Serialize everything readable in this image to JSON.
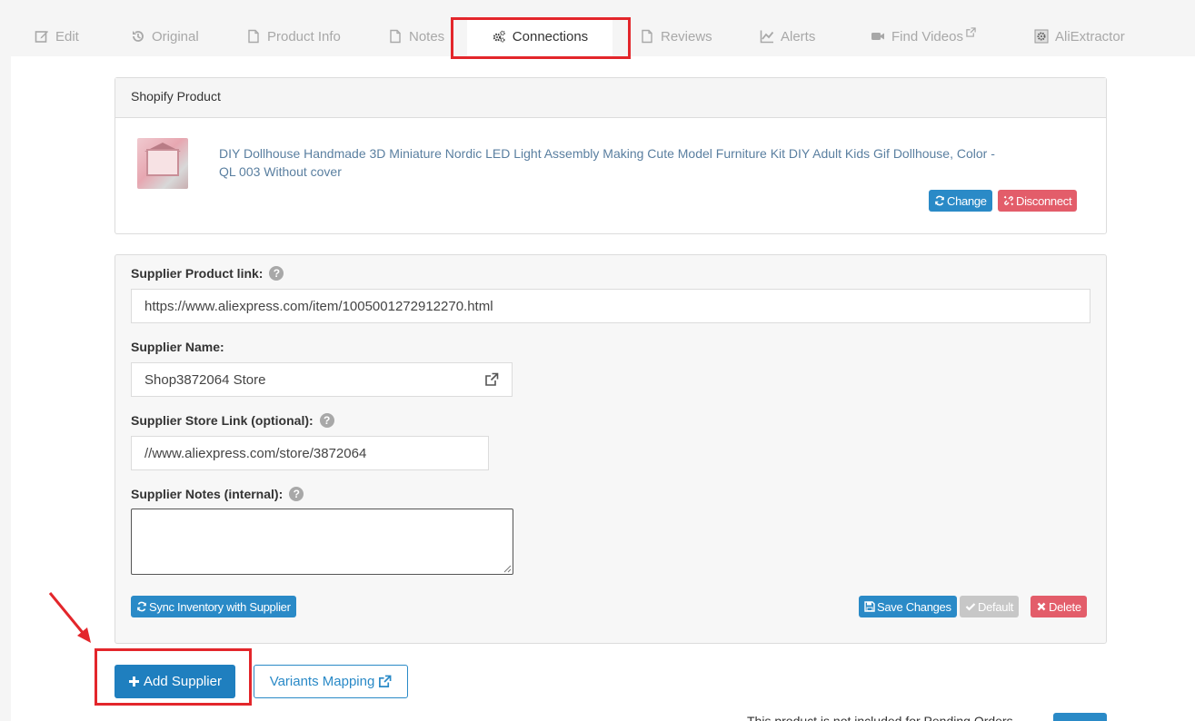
{
  "tabs": [
    {
      "label": "Edit",
      "icon": "edit-icon"
    },
    {
      "label": "Original",
      "icon": "history-icon"
    },
    {
      "label": "Product Info",
      "icon": "file-icon"
    },
    {
      "label": "Notes",
      "icon": "file-icon"
    },
    {
      "label": "Connections",
      "icon": "gears-icon",
      "active": true
    },
    {
      "label": "Reviews",
      "icon": "file-icon"
    },
    {
      "label": "Alerts",
      "icon": "chart-icon"
    },
    {
      "label": "Find Videos",
      "icon": "video-icon"
    },
    {
      "label": "AliExtractor",
      "icon": "aliextractor-icon"
    }
  ],
  "shopify": {
    "heading": "Shopify Product",
    "product_title": "DIY Dollhouse Handmade 3D Miniature Nordic LED Light Assembly Making Cute Model Furniture Kit DIY Adult Kids Gif Dollhouse, Color - QL 003 Without cover",
    "change_label": "Change",
    "disconnect_label": "Disconnect"
  },
  "supplier": {
    "link_label": "Supplier Product link:",
    "link_value": "https://www.aliexpress.com/item/1005001272912270.html",
    "name_label": "Supplier Name:",
    "name_value": "Shop3872064 Store",
    "store_link_label": "Supplier Store Link (optional):",
    "store_link_value": "//www.aliexpress.com/store/3872064",
    "notes_label": "Supplier Notes (internal):",
    "notes_value": "",
    "sync_label": "Sync Inventory with Supplier",
    "save_label": "Save Changes",
    "default_label": "Default",
    "delete_label": "Delete"
  },
  "actions": {
    "add_supplier_label": "Add Supplier",
    "variants_mapping_label": "Variants Mapping"
  },
  "footer": {
    "partial_text": "This product is not included for Pending Orders"
  },
  "colors": {
    "primary": "#2a8ac7",
    "danger": "#e35d6a",
    "highlight": "#e3262b"
  }
}
